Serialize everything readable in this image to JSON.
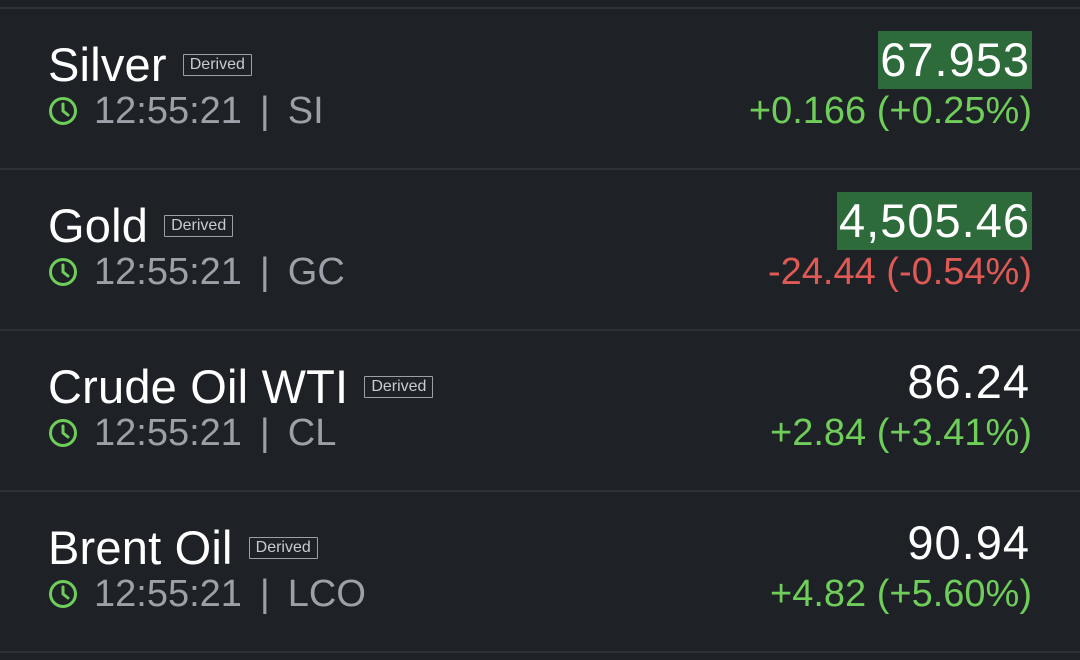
{
  "colors": {
    "background": "#1e2126",
    "divider": "#2d3138",
    "positive": "#6fce5a",
    "negative": "#e05a55",
    "flash_highlight": "#2e6b3a",
    "muted_text": "#9ca1a9"
  },
  "instruments": [
    {
      "name": "Silver",
      "badge": "Derived",
      "time": "12:55:21",
      "separator": "|",
      "symbol": "SI",
      "price": "67.953",
      "change": "+0.166 (+0.25%)",
      "direction": "up",
      "price_highlighted": true,
      "icon": "clock-icon"
    },
    {
      "name": "Gold",
      "badge": "Derived",
      "time": "12:55:21",
      "separator": "|",
      "symbol": "GC",
      "price": "4,505.46",
      "change": "-24.44 (-0.54%)",
      "direction": "down",
      "price_highlighted": true,
      "icon": "clock-icon"
    },
    {
      "name": "Crude Oil WTI",
      "badge": "Derived",
      "time": "12:55:21",
      "separator": "|",
      "symbol": "CL",
      "price": "86.24",
      "change": "+2.84 (+3.41%)",
      "direction": "up",
      "price_highlighted": false,
      "icon": "clock-icon"
    },
    {
      "name": "Brent Oil",
      "badge": "Derived",
      "time": "12:55:21",
      "separator": "|",
      "symbol": "LCO",
      "price": "90.94",
      "change": "+4.82 (+5.60%)",
      "direction": "up",
      "price_highlighted": false,
      "icon": "clock-icon"
    }
  ]
}
